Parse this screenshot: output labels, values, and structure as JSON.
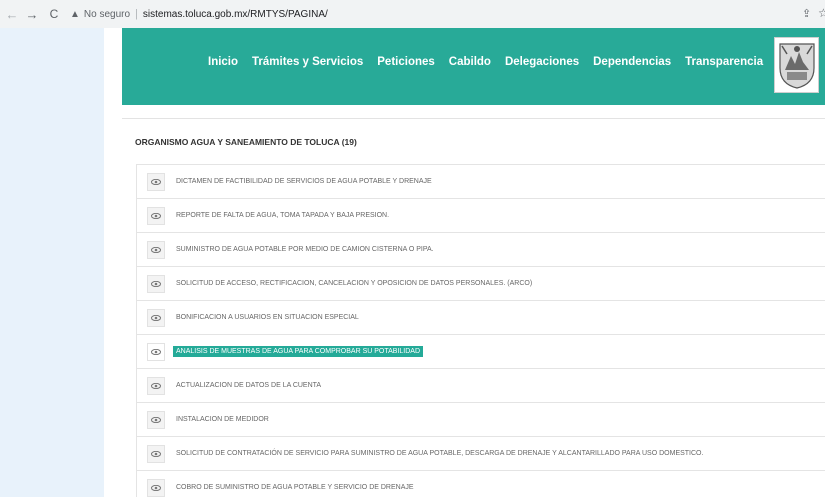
{
  "browser": {
    "security_label": "No seguro",
    "separator": "|",
    "url": "sistemas.toluca.gob.mx/RMTYS/PAGINA/"
  },
  "nav": {
    "items": [
      {
        "label": "Inicio"
      },
      {
        "label": "Trámites y Servicios"
      },
      {
        "label": "Peticiones"
      },
      {
        "label": "Cabildo"
      },
      {
        "label": "Delegaciones"
      },
      {
        "label": "Dependencias"
      },
      {
        "label": "Transparencia"
      }
    ]
  },
  "section": {
    "title": "ORGANISMO AGUA Y SANEAMIENTO DE TOLUCA (19)"
  },
  "services": [
    {
      "label": "DICTAMEN DE FACTIBILIDAD DE SERVICIOS DE AGUA POTABLE Y DRENAJE"
    },
    {
      "label": "REPORTE DE FALTA DE AGUA, TOMA TAPADA Y BAJA PRESION."
    },
    {
      "label": "SUMINISTRO DE AGUA POTABLE POR MEDIO DE CAMION CISTERNA O PIPA."
    },
    {
      "label": "SOLICITUD DE ACCESO, RECTIFICACION, CANCELACION Y OPOSICION DE DATOS PERSONALES. (ARCO)"
    },
    {
      "label": "BONIFICACION A USUARIOS EN SITUACION ESPECIAL"
    },
    {
      "label": "ANALISIS DE MUESTRAS DE AGUA PARA COMPROBAR SU POTABILIDAD"
    },
    {
      "label": "ACTUALIZACION DE DATOS DE LA CUENTA"
    },
    {
      "label": "INSTALACION DE MEDIDOR"
    },
    {
      "label": "SOLICITUD DE CONTRATACIÓN DE SERVICIO PARA SUMINISTRO DE AGUA POTABLE, DESCARGA DE DRENAJE Y ALCANTARILLADO PARA USO DOMESTICO."
    },
    {
      "label": "COBRO DE SUMINISTRO DE AGUA POTABLE Y SERVICIO DE DRENAJE"
    }
  ],
  "colors": {
    "header": "#28aa98",
    "highlight": "#24aa98"
  }
}
